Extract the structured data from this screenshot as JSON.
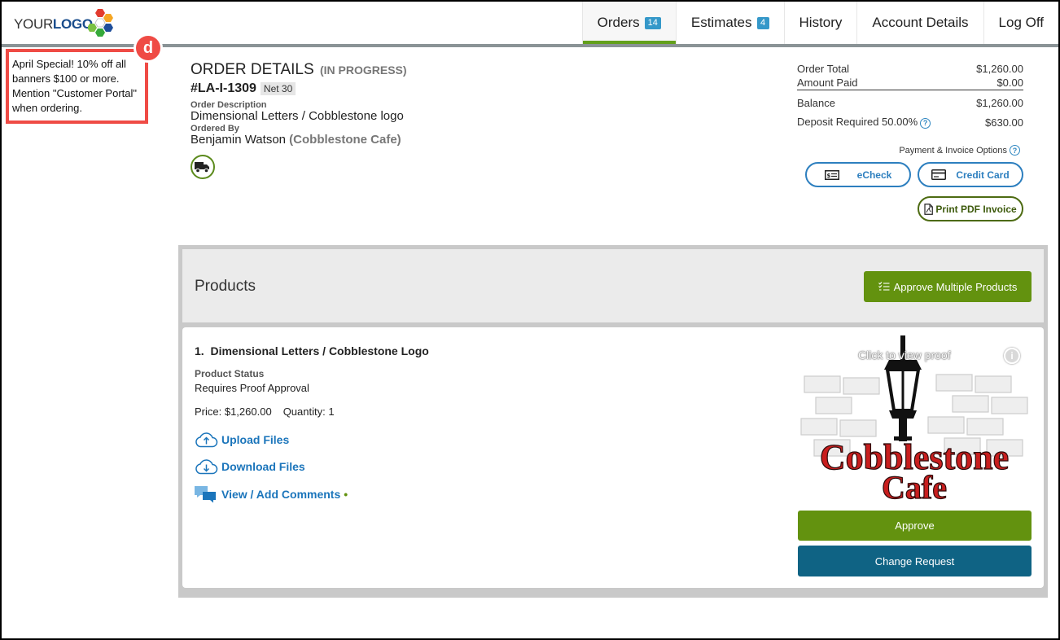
{
  "brand": {
    "logo_part1": "YOUR",
    "logo_part2": "LOGO"
  },
  "nav": {
    "orders": {
      "label": "Orders",
      "count": "14"
    },
    "estimates": {
      "label": "Estimates",
      "count": "4"
    },
    "history": {
      "label": "History"
    },
    "account": {
      "label": "Account Details"
    },
    "logoff": {
      "label": "Log Off"
    }
  },
  "promo": {
    "badge": "d",
    "text": "April Special! 10% off all banners $100 or more. Mention \"Customer Portal\" when ordering."
  },
  "order": {
    "title": "ORDER DETAILS",
    "status": "(IN PROGRESS)",
    "number": "#LA-I-1309",
    "terms": "Net 30",
    "description_label": "Order Description",
    "description": "Dimensional Letters / Cobblestone logo",
    "ordered_by_label": "Ordered By",
    "ordered_by": "Benjamin Watson",
    "company": "(Cobblestone Cafe)"
  },
  "totals": {
    "order_total_label": "Order Total",
    "order_total": "$1,260.00",
    "amount_paid_label": "Amount Paid",
    "amount_paid": "$0.00",
    "balance_label": "Balance",
    "balance": "$1,260.00",
    "deposit_label": "Deposit Required 50.00%",
    "deposit": "$630.00"
  },
  "payment": {
    "options_label": "Payment & Invoice Options",
    "echeck": "eCheck",
    "credit_card": "Credit Card",
    "print_invoice": "Print PDF Invoice"
  },
  "products": {
    "title": "Products",
    "approve_multiple": "Approve Multiple Products",
    "items": [
      {
        "name": "1.  Dimensional Letters / Cobblestone Logo",
        "status_label": "Product Status",
        "status": "Requires Proof Approval",
        "price": "Price: $1,260.00",
        "quantity": "Quantity: 1",
        "upload": "Upload Files",
        "download": "Download Files",
        "comments": "View / Add Comments",
        "comments_dot": "•",
        "proof_caption": "Click to view proof",
        "proof_line1": "Cobblestone",
        "proof_line2": "Cafe",
        "info_symbol": "i",
        "approve": "Approve",
        "change_request": "Change Request"
      }
    ]
  },
  "colors": {
    "accent_green": "#63920f",
    "nav_active": "#63a01c",
    "link_blue": "#1b75bb",
    "change_blue": "#0f6384",
    "promo_red": "#ef4b45",
    "logo_red": "#c81e1e"
  }
}
